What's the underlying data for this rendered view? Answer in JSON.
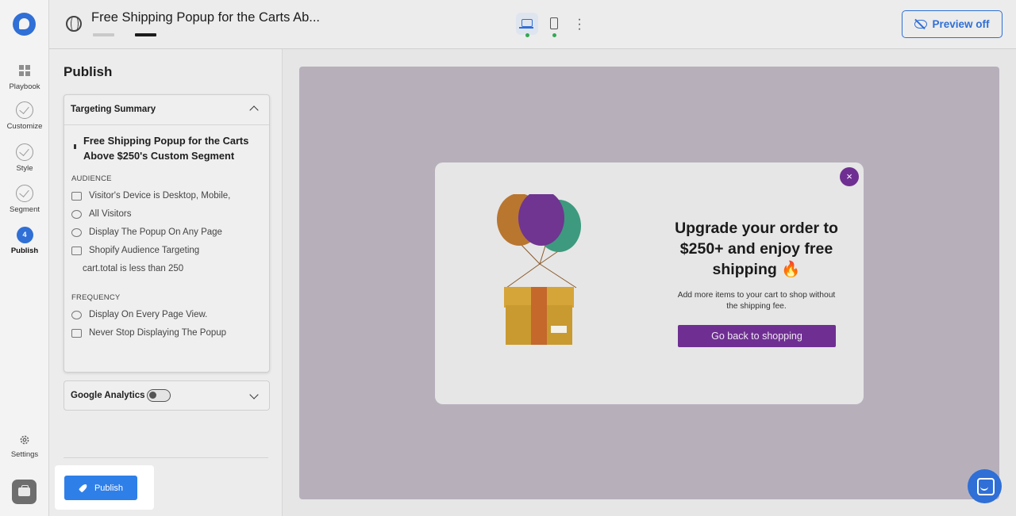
{
  "header": {
    "title": "Free Shipping Popup for the Carts Ab...",
    "preview_label": "Preview off"
  },
  "rail": {
    "items": [
      {
        "label": "Playbook"
      },
      {
        "label": "Customize"
      },
      {
        "label": "Style"
      },
      {
        "label": "Segment"
      },
      {
        "label": "Publish",
        "step": "4"
      }
    ],
    "settings_label": "Settings"
  },
  "panel": {
    "heading": "Publish",
    "summary": {
      "title": "Targeting Summary",
      "segment_name": "Free Shipping Popup for the Carts Above $250's Custom Segment",
      "audience_label": "AUDIENCE",
      "audience": [
        "Visitor's Device is Desktop, Mobile,",
        "All Visitors",
        "Display The Popup On Any Page",
        "Shopify Audience Targeting"
      ],
      "condition": "cart.total is less than 250",
      "frequency_label": "FREQUENCY",
      "frequency": [
        "Display On Every Page View.",
        "Never Stop Displaying The Popup"
      ]
    },
    "google_analytics": {
      "title": "Google Analytics",
      "enabled": false
    },
    "publish_label": "Publish"
  },
  "popup": {
    "title": "Upgrade your order to $250+ and enjoy free shipping 🔥",
    "subtitle": "Add more items to your cart to shop without the shipping fee.",
    "cta": "Go back to shopping",
    "close": "×"
  },
  "colors": {
    "accent": "#2f6fd6",
    "popup_brand": "#6f2f92",
    "canvas_bg": "#b7b0bb"
  }
}
